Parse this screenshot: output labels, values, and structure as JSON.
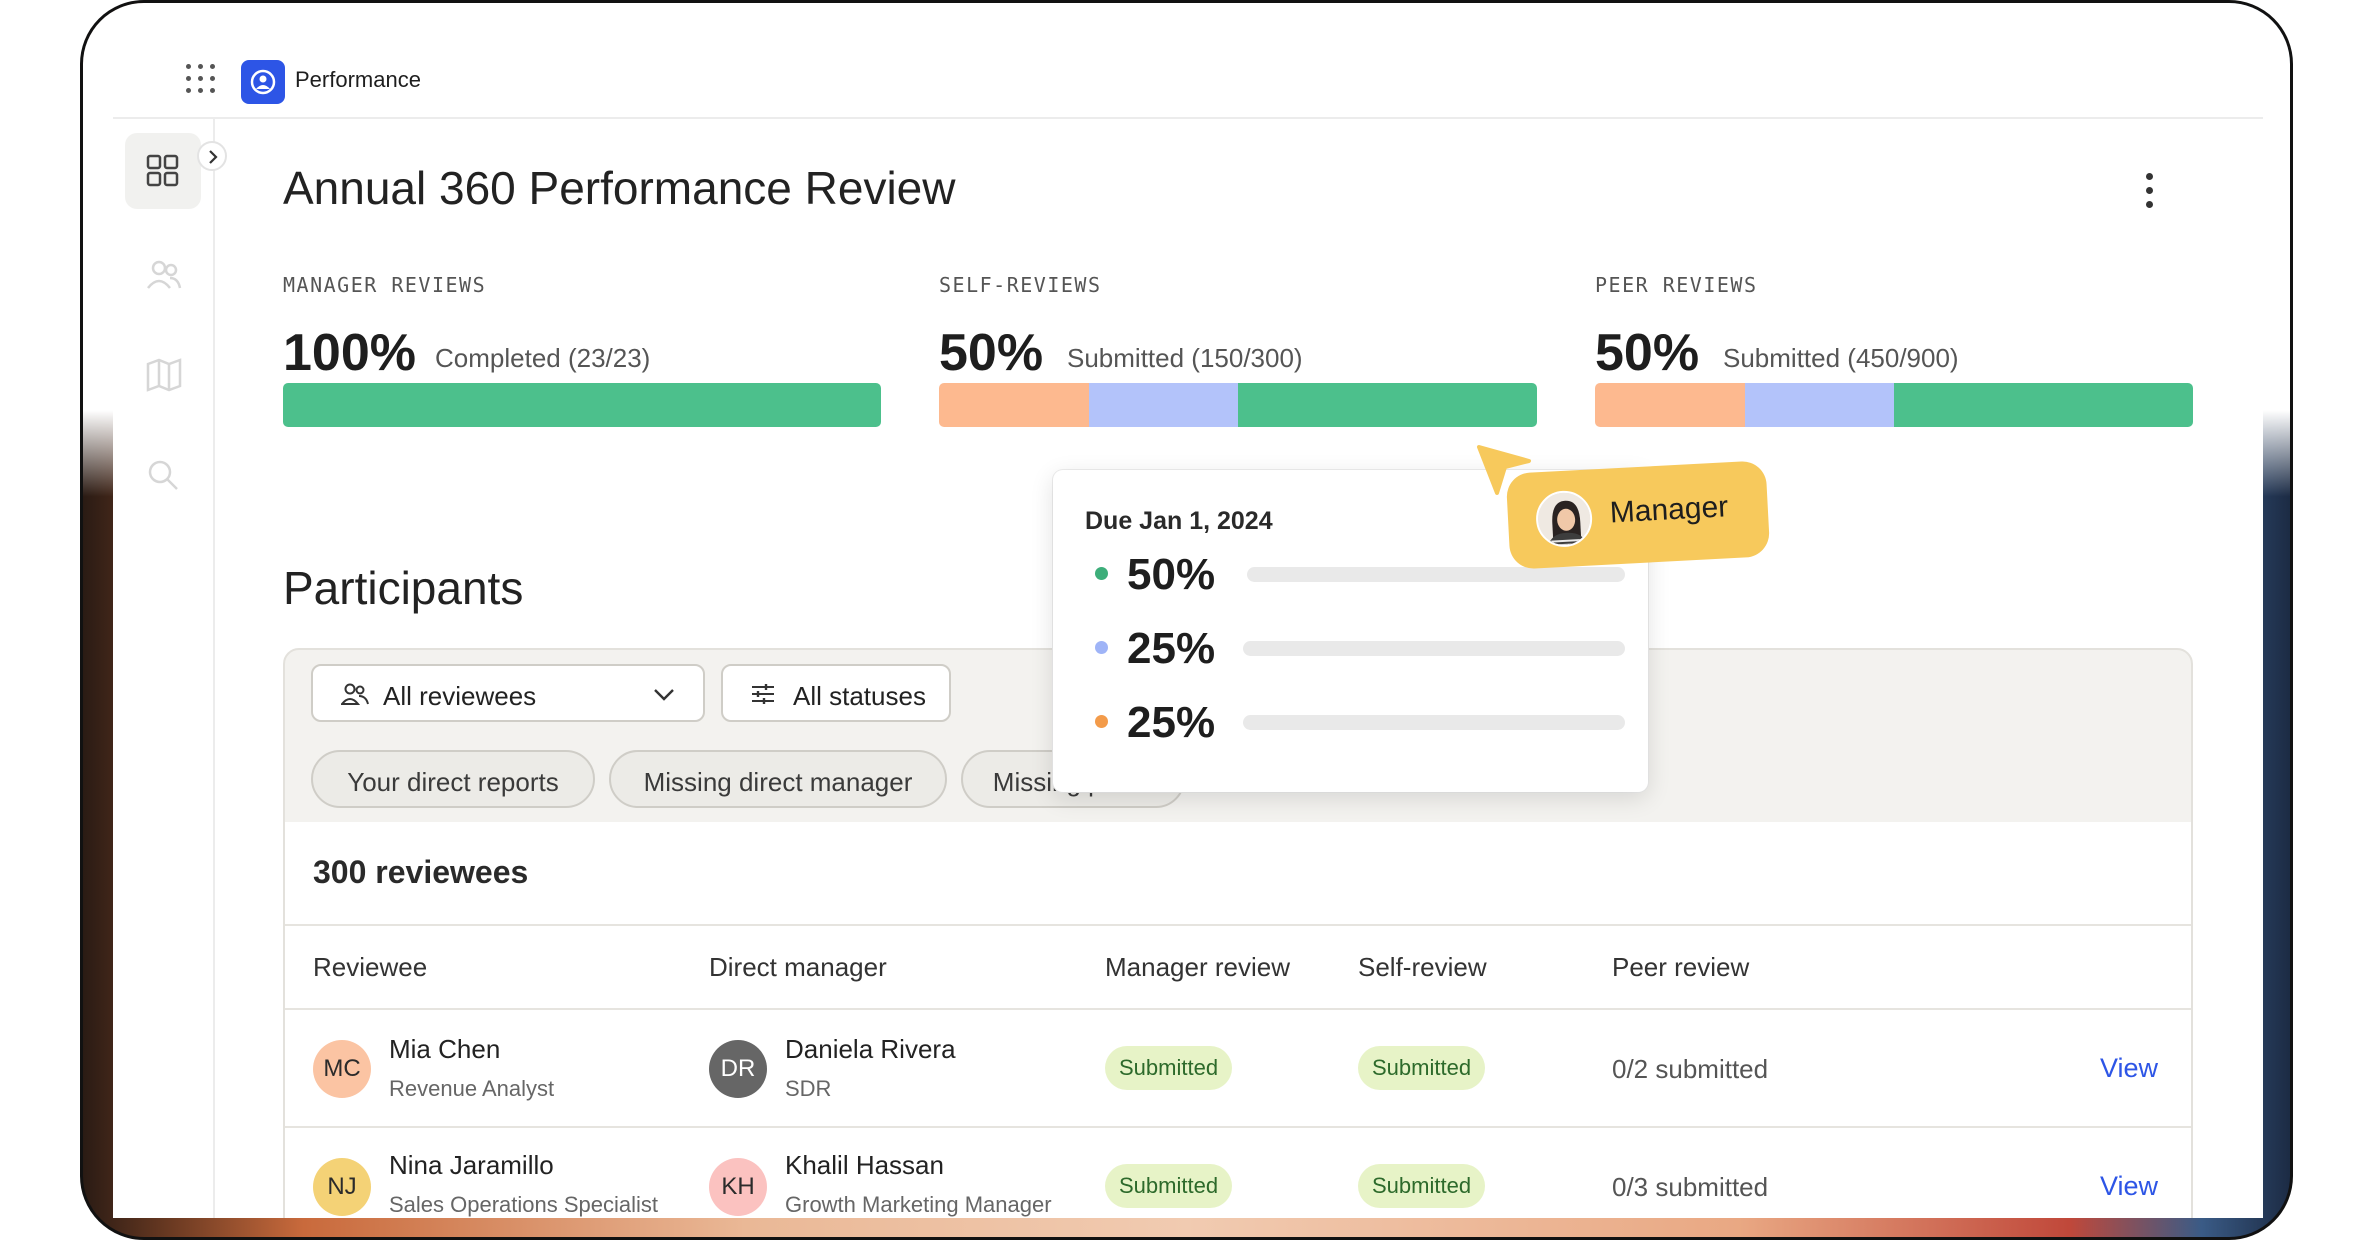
{
  "app": {
    "name": "Performance",
    "icons": {
      "apps": "grid-dots-icon",
      "logo": "performance-logo-icon"
    }
  },
  "sidebar": {
    "items": [
      {
        "name": "dashboard",
        "icon": "dashboard-icon",
        "active": true
      },
      {
        "name": "people",
        "icon": "people-icon",
        "active": false
      },
      {
        "name": "library",
        "icon": "book-icon",
        "active": false
      },
      {
        "name": "search",
        "icon": "search-icon",
        "active": false
      }
    ]
  },
  "page": {
    "title": "Annual 360 Performance Review"
  },
  "stats": {
    "manager": {
      "label": "MANAGER REVIEWS",
      "pct": "100%",
      "desc": "Completed (23/23)",
      "segments": [
        {
          "color": "#4cc08c",
          "fraction": 1.0
        }
      ]
    },
    "self": {
      "label": "SELF-REVIEWS",
      "pct": "50%",
      "desc": "Submitted (150/300)",
      "segments": [
        {
          "color": "#fdb98f",
          "fraction": 0.25
        },
        {
          "color": "#b3c3fa",
          "fraction": 0.25
        },
        {
          "color": "#4cc08c",
          "fraction": 0.5
        }
      ]
    },
    "peer": {
      "label": "PEER REVIEWS",
      "pct": "50%",
      "desc": "Submitted (450/900)",
      "segments": [
        {
          "color": "#fdb98f",
          "fraction": 0.25
        },
        {
          "color": "#b3c3fa",
          "fraction": 0.25
        },
        {
          "color": "#4cc08c",
          "fraction": 0.5
        }
      ]
    }
  },
  "tooltip": {
    "title": "Due Jan 1, 2024",
    "rows": [
      {
        "pct": "50%",
        "color": "#3dae7a"
      },
      {
        "pct": "25%",
        "color": "#9fb4f7"
      },
      {
        "pct": "25%",
        "color": "#f39b4a"
      }
    ]
  },
  "cursor_tag": {
    "label": "Manager"
  },
  "participants": {
    "title": "Participants",
    "filters": {
      "reviewees": "All reviewees",
      "statuses": "All statuses"
    },
    "chips": [
      "Your direct reports",
      "Missing direct manager",
      "Missing peers"
    ],
    "count": "300 reviewees",
    "columns": [
      "Reviewee",
      "Direct manager",
      "Manager review",
      "Self-review",
      "Peer review"
    ],
    "rows": [
      {
        "initials": "MC",
        "name": "Mia Chen",
        "role": "Revenue Analyst",
        "avatar_color": "#fbc4a3",
        "mgr_initials": "DR",
        "mgr_name": "Daniela Rivera",
        "mgr_role": "SDR",
        "mgr_avatar_color": "#666666",
        "manager_review": "Submitted",
        "self_review": "Submitted",
        "peer_review": "0/2 submitted",
        "action": "View"
      },
      {
        "initials": "NJ",
        "name": "Nina Jaramillo",
        "role": "Sales Operations Specialist",
        "avatar_color": "#f4d276",
        "mgr_initials": "KH",
        "mgr_name": "Khalil Hassan",
        "mgr_role": "Growth Marketing Manager",
        "mgr_avatar_color": "#fbc2c0",
        "manager_review": "Submitted",
        "self_review": "Submitted",
        "peer_review": "0/3 submitted",
        "action": "View"
      }
    ]
  }
}
